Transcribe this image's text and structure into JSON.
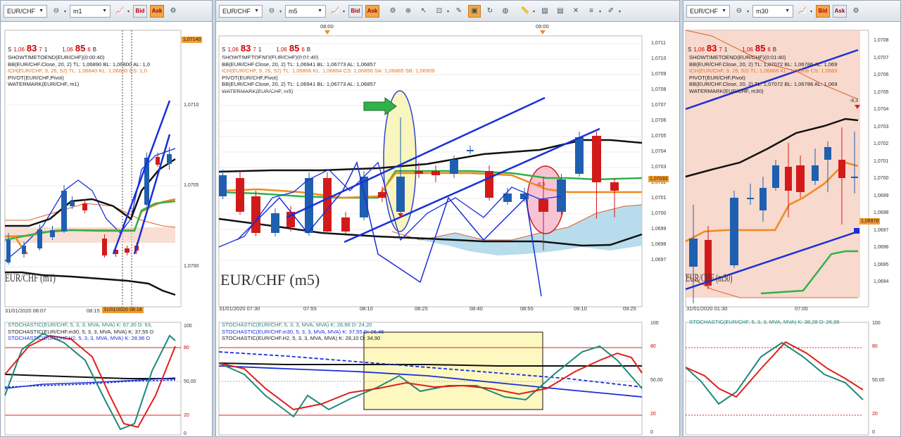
{
  "panels": [
    {
      "symbol": "EUR/CHF",
      "timeframe": "m1",
      "bid": "Bid",
      "ask": "Ask",
      "quote": {
        "s": "S",
        "bid_pre": "1,06",
        "bid_big": "83",
        "bid_sup": "7",
        "size": "1",
        "ask_pre": "1,06",
        "ask_big": "85",
        "ask_sup": "6",
        "b": "B"
      },
      "legend": [
        "SHOWTIMETOEND(EUR/CHF)(0:00:40)",
        "BB(EUR/CHF.Close, 20, 2)  TL: 1,06890  BL: 1,06800  AL: 1,0",
        "ICH(EUR/CHF, 9, 26, 52)  TL: 1,06840  KL: 1,06860  CS: 1,0",
        "PIVOT(EUR/CHF,Pivot)",
        "WATERMARK(EUR/CHF, m1)"
      ],
      "price_axis": [
        "1,0710",
        "1,0705",
        "1,0700"
      ],
      "price_box": "1,07140",
      "time_axis": [
        "31/01/2020 08:07",
        "08:15"
      ],
      "time_cursor": "31/01/2020 08:18",
      "watermark": "EUR/CHF (m1)",
      "stoch_legend": [
        "STOCHASTIC(EUR/CHF, 5, 3, 3, MVA, MVA)  K: 67,30  D: 63,",
        "STOCHASTIC(EUR/CHF.m30, 5, 3, 3, MVA, MVA)  K: 37,55  D",
        "STOCHASTIC(EUR/CHF.H2, 5, 3, 3, MVA, MVA)  K: 28,96  D"
      ],
      "stoch_axis": [
        "100",
        "80",
        "50,00",
        "20",
        "0"
      ]
    },
    {
      "symbol": "EUR/CHF",
      "timeframe": "m5",
      "bid": "Bid",
      "ask": "Ask",
      "quote": {
        "s": "S",
        "bid_pre": "1,06",
        "bid_big": "83",
        "bid_sup": "7",
        "size": "1",
        "ask_pre": "1,06",
        "ask_big": "85",
        "ask_sup": "6",
        "b": "B"
      },
      "legend": [
        "SHOWTIMETOEND(EUR/CHF)(0:01:40)",
        "BB(EUR/CHF.Close, 20, 2)  TL: 1,06941  BL: 1,06773  AL: 1,06857",
        "ICH(EUR/CHF, 9, 26, 52)  TL: 1,06866  KL: 1,06864  CS: 1,06856  SA: 1,06865  SB: 1,06909",
        "PIVOT(EUR/CHF,Pivot)",
        "BB(EUR/CHF.Close, 20, 2)  TL: 1,06941  BL: 1,06773  AL: 1,06857",
        "WATERMARK(EUR/CHF, m5)"
      ],
      "price_axis": [
        "1,0711",
        "1,0710",
        "1,0709",
        "1,0708",
        "1,0707",
        "1,0706",
        "1,0705",
        "1,0704",
        "1,0703",
        "1,0702",
        "1,0701",
        "1,0700",
        "1,0699",
        "1,0698",
        "1,0697"
      ],
      "price_box": "1,07033",
      "top_times": [
        "08:00",
        "09:00"
      ],
      "time_axis": [
        "31/01/2020 07:30",
        "07:55",
        "08:10",
        "08:25",
        "08:40",
        "08:55",
        "09:10",
        "09:25"
      ],
      "watermark": "EUR/CHF (m5)",
      "marker": "-8,3",
      "stoch_legend": [
        "STOCHASTIC(EUR/CHF, 5, 3, 3, MVA, MVA)  K: 28,96  D: 24,20",
        "STOCHASTIC(EUR/CHF.m30, 5, 3, 3, MVA, MVA)  K: 37,55  D: 26,45",
        "STOCHASTIC(EUR/CHF.H2, 5, 3, 3, MVA, MVA)  K: 28,10  D: 34,90"
      ],
      "stoch_axis": [
        "100",
        "80",
        "50,00",
        "20",
        "0"
      ]
    },
    {
      "symbol": "EUR/CHF",
      "timeframe": "m30",
      "bid": "Bid",
      "ask": "Ask",
      "quote": {
        "s": "S",
        "bid_pre": "1,06",
        "bid_big": "83",
        "bid_sup": "7",
        "size": "1",
        "ask_pre": "1,06",
        "ask_big": "85",
        "ask_sup": "6",
        "b": "B"
      },
      "legend": [
        "SHOWTIMETOEND(EUR/CHF)(0:01:40)",
        "BB(EUR/CHF.Close, 20, 2)  TL: 1,07072  BL: 1,06786  AL: 1,069",
        "ICH(EUR/CHF, 9, 26, 52)  TL: 1,06866  KL: 1,06906  CS: 1,0683",
        "PIVOT(EUR/CHF,Pivot)",
        "BB(EUR/CHF.Close, 20, 2)  TL: 1,07072  BL: 1,06786  AL: 1,069",
        "WATERMARK(EUR/CHF, m30)"
      ],
      "price_axis": [
        "1,0708",
        "1,0707",
        "1,0706",
        "1,0705",
        "1,0704",
        "1,0703",
        "1,0702",
        "1,0701",
        "1,0700",
        "1,0699",
        "1,0698",
        "1,0697",
        "1,0696",
        "1,0695",
        "1,0694"
      ],
      "price_box": "1,06978",
      "time_axis": [
        "31/01/2020 01:30",
        "07:00"
      ],
      "watermark": "EUR/CHF (m30)",
      "marker": "-8,3",
      "stoch_legend": [
        "STOCHASTIC(EUR/CHF, 5, 3, 3, MVA, MVA)  K: 38,28  D: 26,99"
      ],
      "stoch_axis": [
        "100",
        "80",
        "50,00",
        "20",
        "0"
      ]
    }
  ],
  "colors": {
    "bull": "#1f5fb0",
    "bear": "#d21a1a",
    "bb": "#111111",
    "ich_tl": "#f08a1e",
    "ich_kl": "#2fb24a",
    "trend": "#1a2fd6",
    "stoch_k": "#1e8a7a",
    "stoch_d": "#e0201a",
    "cloud": "#b8dcec"
  }
}
